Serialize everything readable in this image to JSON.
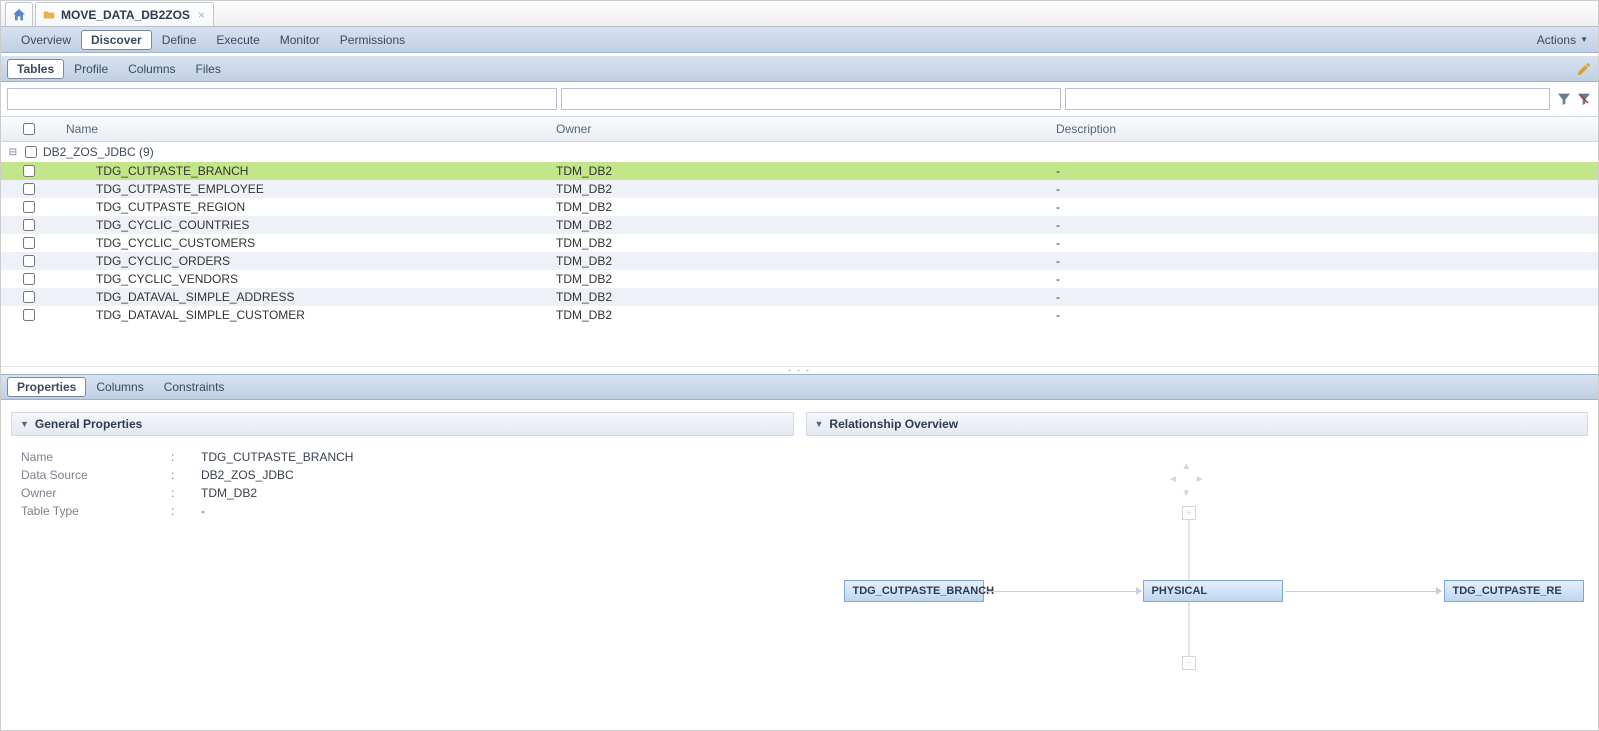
{
  "tab_title": "MOVE_DATA_DB2ZOS",
  "menu": {
    "items": [
      "Overview",
      "Discover",
      "Define",
      "Execute",
      "Monitor",
      "Permissions"
    ],
    "active": "Discover",
    "actions_label": "Actions"
  },
  "subtabs": {
    "items": [
      "Tables",
      "Profile",
      "Columns",
      "Files"
    ],
    "active": "Tables"
  },
  "columns": {
    "name": "Name",
    "owner": "Owner",
    "description": "Description"
  },
  "group": {
    "label": "DB2_ZOS_JDBC (9)"
  },
  "rows": [
    {
      "name": "TDG_CUTPASTE_BRANCH",
      "owner": "TDM_DB2",
      "desc": "-",
      "selected": true
    },
    {
      "name": "TDG_CUTPASTE_EMPLOYEE",
      "owner": "TDM_DB2",
      "desc": "-"
    },
    {
      "name": "TDG_CUTPASTE_REGION",
      "owner": "TDM_DB2",
      "desc": "-"
    },
    {
      "name": "TDG_CYCLIC_COUNTRIES",
      "owner": "TDM_DB2",
      "desc": "-"
    },
    {
      "name": "TDG_CYCLIC_CUSTOMERS",
      "owner": "TDM_DB2",
      "desc": "-"
    },
    {
      "name": "TDG_CYCLIC_ORDERS",
      "owner": "TDM_DB2",
      "desc": "-"
    },
    {
      "name": "TDG_CYCLIC_VENDORS",
      "owner": "TDM_DB2",
      "desc": "-"
    },
    {
      "name": "TDG_DATAVAL_SIMPLE_ADDRESS",
      "owner": "TDM_DB2",
      "desc": "-"
    },
    {
      "name": "TDG_DATAVAL_SIMPLE_CUSTOMER",
      "owner": "TDM_DB2",
      "desc": "-"
    }
  ],
  "bottom_tabs": {
    "items": [
      "Properties",
      "Columns",
      "Constraints"
    ],
    "active": "Properties"
  },
  "general": {
    "title": "General Properties",
    "lines": [
      {
        "label": "Name",
        "value": "TDG_CUTPASTE_BRANCH"
      },
      {
        "label": "Data Source",
        "value": "DB2_ZOS_JDBC"
      },
      {
        "label": "Owner",
        "value": "TDM_DB2"
      },
      {
        "label": "Table Type",
        "value": "-"
      }
    ]
  },
  "relationship": {
    "title": "Relationship Overview",
    "nodes": [
      "TDG_CUTPASTE_BRANCH",
      "PHYSICAL",
      "TDG_CUTPASTE_RE"
    ]
  }
}
